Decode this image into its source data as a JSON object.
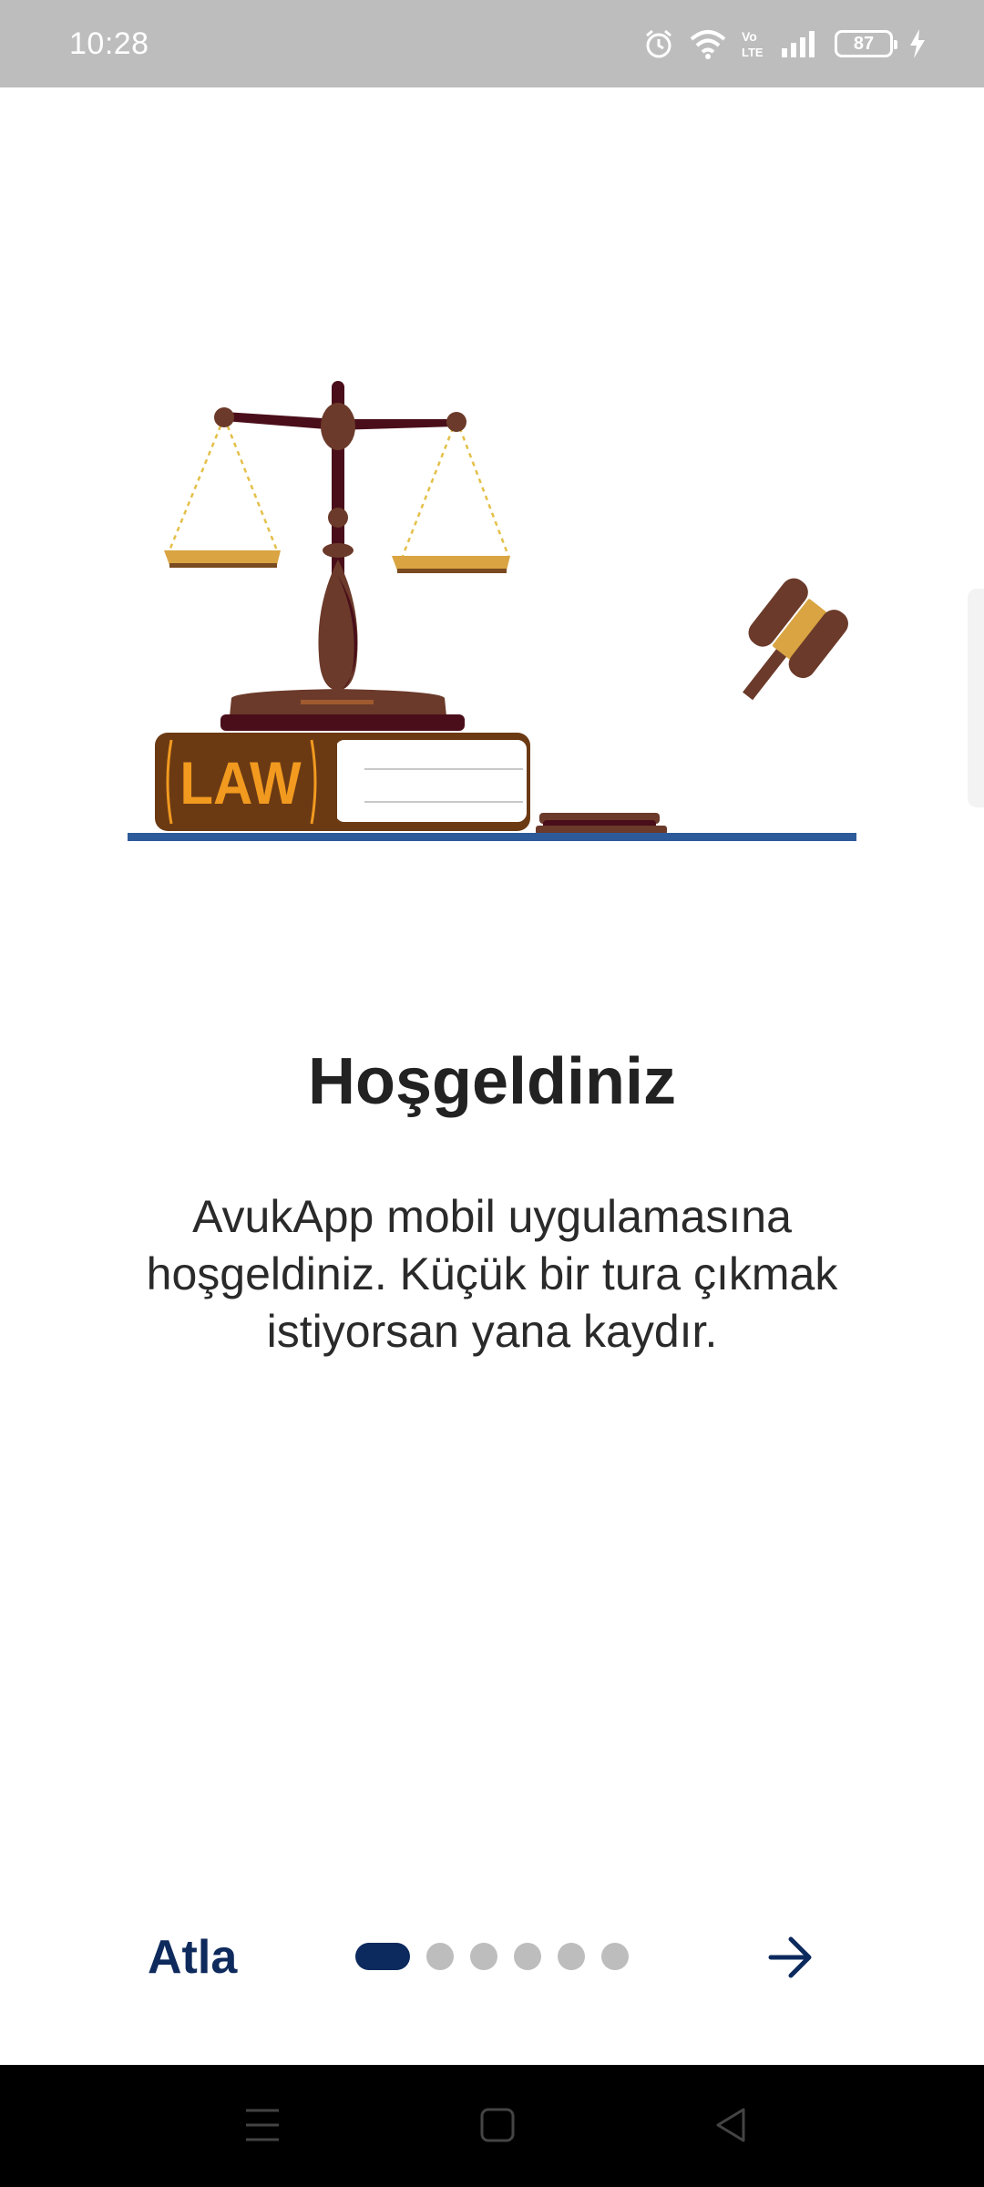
{
  "status_bar": {
    "time": "10:28",
    "battery": "87",
    "icons": [
      "alarm-icon",
      "wifi-icon",
      "volte-icon",
      "signal-icon",
      "battery-icon",
      "charging-icon"
    ]
  },
  "illustration": {
    "book_label": "LAW",
    "icons": [
      "scales-of-justice-icon",
      "law-book-icon",
      "gavel-icon"
    ]
  },
  "onboarding": {
    "title": "Hoşgeldiniz",
    "description": "AvukApp mobil uygulamasına hoşgeldiniz. Küçük bir tura çıkmak istiyorsan yana kaydır."
  },
  "bottom_nav": {
    "skip_label": "Atla",
    "page_count": 6,
    "current_page": 1,
    "next_icon": "arrow-right-icon"
  },
  "system_nav": {
    "icons": [
      "menu-icon",
      "home-icon",
      "back-icon"
    ]
  },
  "colors": {
    "primary": "#0d2a5e",
    "status_bar": "#bdbdbd",
    "dot_inactive": "#bdbdbd",
    "book_label": "#f29a1f",
    "floor_line": "#2d5b9a"
  }
}
